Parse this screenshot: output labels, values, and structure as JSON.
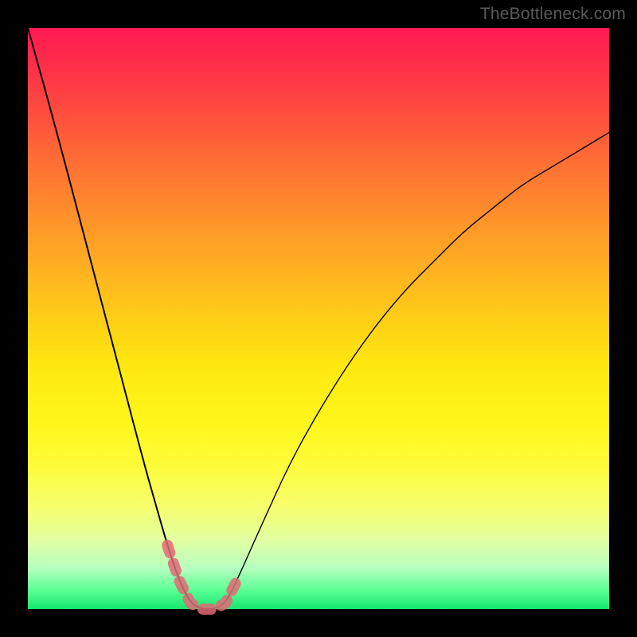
{
  "watermark": "TheBottleneck.com",
  "colors": {
    "page_bg": "#000000",
    "watermark": "#5a5a5a",
    "curve": "#000000",
    "highlight": "#e06a75",
    "gradient_top": "#ff1852",
    "gradient_bottom": "#16e66f"
  },
  "chart_data": {
    "type": "line",
    "title": "",
    "xlabel": "",
    "ylabel": "",
    "x": [
      0,
      5,
      10,
      15,
      20,
      22,
      24,
      26,
      28,
      30,
      32,
      34,
      36,
      40,
      45,
      50,
      55,
      60,
      65,
      70,
      75,
      80,
      85,
      90,
      95,
      100
    ],
    "values": [
      100,
      82,
      63,
      44,
      25,
      18,
      11,
      5,
      1,
      0,
      0,
      1,
      5,
      14,
      25,
      34,
      42,
      49,
      55,
      60,
      65,
      69,
      73,
      76,
      79,
      82
    ],
    "ylim": [
      0,
      100
    ],
    "xlim": [
      0,
      100
    ],
    "highlight_range": {
      "x_start": 24,
      "x_end": 36,
      "description": "dashed pink segment near minimum of curve"
    },
    "note": "Values are read-off estimates from pixel positions; chart has no tick labels or axis text."
  }
}
